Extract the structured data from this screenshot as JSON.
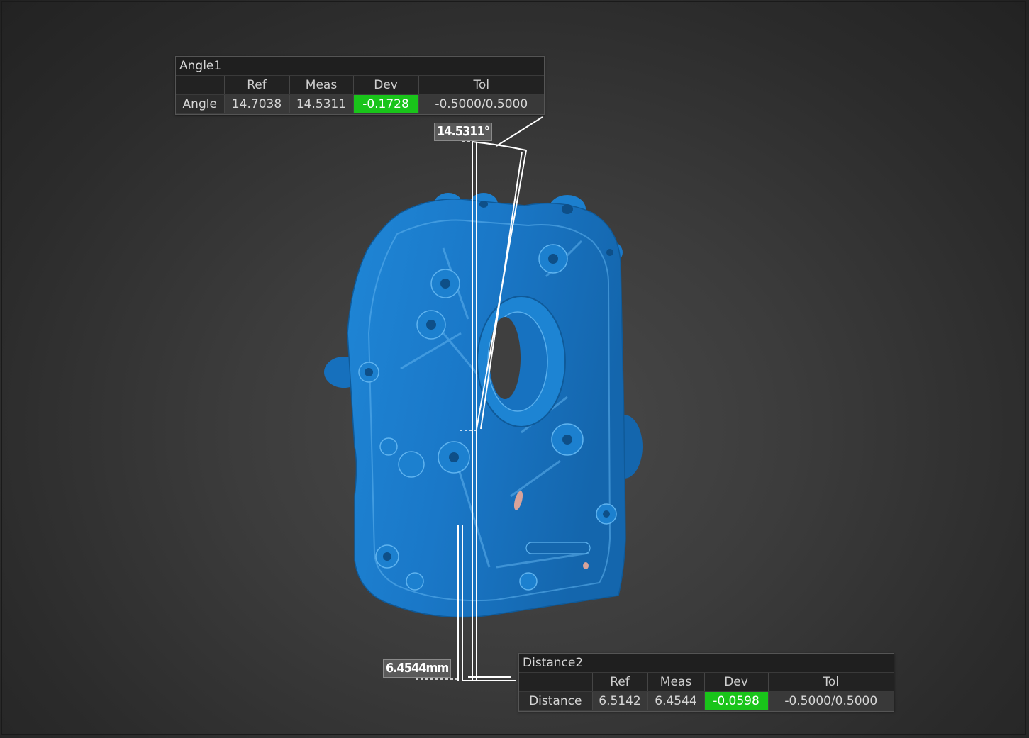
{
  "viewport": {
    "part_color": "#1a78c8",
    "accent_ok": "#19c41a"
  },
  "angle_callout": {
    "title": "Angle1",
    "headers": [
      "",
      "Ref",
      "Meas",
      "Dev",
      "Tol"
    ],
    "row": {
      "label": "Angle",
      "ref": "14.7038",
      "meas": "14.5311",
      "dev": "-0.1728",
      "tol": "-0.5000/0.5000"
    },
    "dim_label": "14.5311°"
  },
  "distance_callout": {
    "title": "Distance2",
    "headers": [
      "",
      "Ref",
      "Meas",
      "Dev",
      "Tol"
    ],
    "row": {
      "label": "Distance",
      "ref": "6.5142",
      "meas": "6.4544",
      "dev": "-0.0598",
      "tol": "-0.5000/0.5000"
    },
    "dim_label": "6.4544mm"
  }
}
